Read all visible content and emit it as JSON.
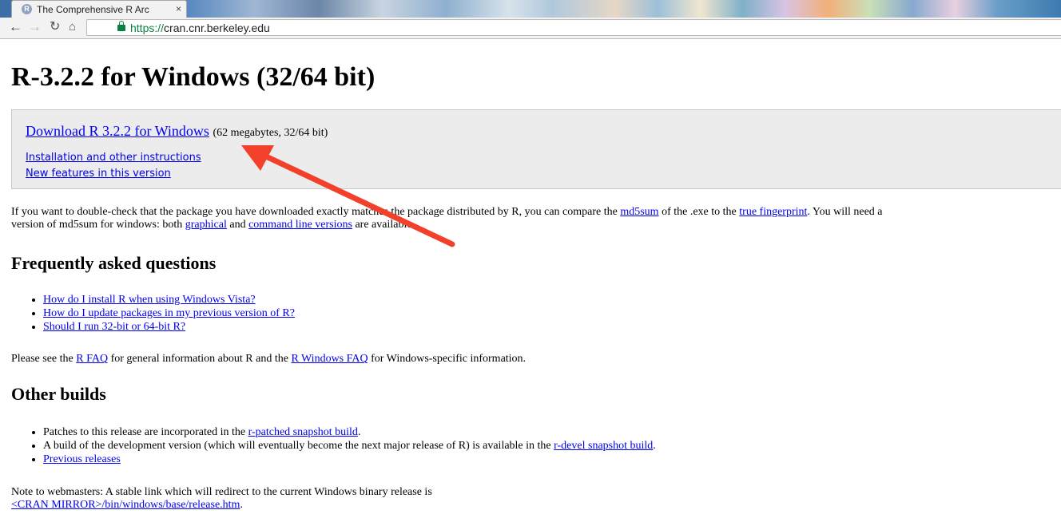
{
  "browser": {
    "tab_title": "The Comprehensive R Arc",
    "tab_close": "×",
    "url_scheme": "https://",
    "url_host": "cran.cnr.berkeley.edu",
    "icons": [
      "back-arrow-icon",
      "forward-arrow-icon",
      "reload-icon",
      "home-icon",
      "lock-icon",
      "r-favicon-icon"
    ]
  },
  "page": {
    "title": "R-3.2.2 for Windows (32/64 bit)",
    "download": {
      "main_link": "Download R 3.2.2 for Windows",
      "main_note": "(62 megabytes, 32/64 bit)",
      "install_link": "Installation and other instructions",
      "new_features_link": "New features in this version"
    },
    "checksum": {
      "t1": "If you want to double-check that the package you have downloaded exactly matches the package distributed by R, you can compare the ",
      "md5sum_link": "md5sum",
      "t2": " of the .exe to the ",
      "fingerprint_link": "true fingerprint",
      "t3": ". You will need a",
      "t4": "version of md5sum for windows: both ",
      "graphical_link": "graphical",
      "t5": " and ",
      "cmdline_link": "command line versions",
      "t6": " are available."
    },
    "faq": {
      "heading": "Frequently asked questions",
      "items": [
        "How do I install R when using Windows Vista?",
        "How do I update packages in my previous version of R?",
        "Should I run 32-bit or 64-bit R?"
      ],
      "see_t1": "Please see the ",
      "rfaq_link": "R FAQ",
      "see_t2": " for general information about R and the ",
      "rwinfaq_link": "R Windows FAQ",
      "see_t3": " for Windows-specific information."
    },
    "other_builds": {
      "heading": "Other builds",
      "b1_text": "Patches to this release are incorporated in the ",
      "b1_link": "r-patched snapshot build",
      "b1_end": ".",
      "b2_text": "A build of the development version (which will eventually become the next major release of R) is available in the ",
      "b2_link": "r-devel snapshot build",
      "b2_end": ".",
      "b3_link": "Previous releases"
    },
    "note": {
      "text": "Note to webmasters: A stable link which will redirect to the current Windows binary release is",
      "link": "<CRAN MIRROR>/bin/windows/base/release.htm",
      "end": "."
    }
  },
  "colors": {
    "link": "#0000ee",
    "annotation_arrow": "#f2402a",
    "secure_green": "#0b8043"
  }
}
